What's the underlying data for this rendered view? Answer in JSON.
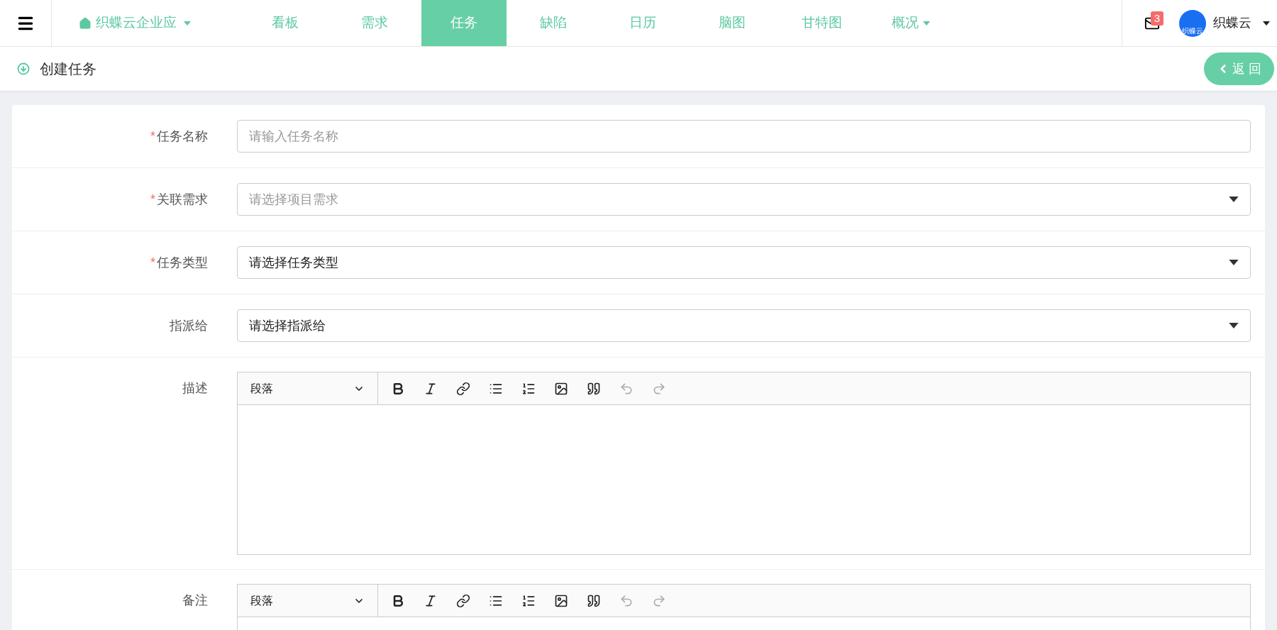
{
  "topbar": {
    "brand": {
      "label": "织蝶云企业应",
      "dropdown": true
    },
    "tabs": [
      {
        "label": "看板",
        "selected": false,
        "dropdown": false
      },
      {
        "label": "需求",
        "selected": false,
        "dropdown": false
      },
      {
        "label": "任务",
        "selected": true,
        "dropdown": false
      },
      {
        "label": "缺陷",
        "selected": false,
        "dropdown": false
      },
      {
        "label": "日历",
        "selected": false,
        "dropdown": false
      },
      {
        "label": "脑图",
        "selected": false,
        "dropdown": false
      },
      {
        "label": "甘特图",
        "selected": false,
        "dropdown": false
      },
      {
        "label": "概况",
        "selected": false,
        "dropdown": true
      }
    ],
    "mail": {
      "badge": "3"
    },
    "user": {
      "avatar_text": "织蝶云",
      "name": "织蝶云"
    }
  },
  "page_header": {
    "title": "创建任务",
    "back_button": "返 回"
  },
  "form": {
    "rows": [
      {
        "kind": "input",
        "required_mark": "*",
        "label": "任务名称",
        "placeholder": "请输入任务名称"
      },
      {
        "kind": "select",
        "required_mark": "*",
        "label": "关联需求",
        "placeholder": "请选择项目需求"
      },
      {
        "kind": "select",
        "required_mark": "*",
        "label": "任务类型",
        "value": "请选择任务类型"
      },
      {
        "kind": "select",
        "label": "指派给",
        "value": "请选择指派给"
      },
      {
        "kind": "editor",
        "label": "描述",
        "format": "段落",
        "tools": [
          {
            "kind": "bold",
            "disabled": false
          },
          {
            "kind": "italic",
            "disabled": false
          },
          {
            "kind": "link",
            "disabled": false
          },
          {
            "kind": "bullet-list",
            "disabled": false
          },
          {
            "kind": "numbered-list",
            "disabled": false
          },
          {
            "kind": "image",
            "disabled": false
          },
          {
            "kind": "quote",
            "disabled": false
          },
          {
            "kind": "undo",
            "disabled": true
          },
          {
            "kind": "redo",
            "disabled": true
          }
        ]
      },
      {
        "kind": "editor",
        "label": "备注",
        "format": "段落",
        "tools": [
          {
            "kind": "bold",
            "disabled": false
          },
          {
            "kind": "italic",
            "disabled": false
          },
          {
            "kind": "link",
            "disabled": false
          },
          {
            "kind": "bullet-list",
            "disabled": false
          },
          {
            "kind": "numbered-list",
            "disabled": false
          },
          {
            "kind": "image",
            "disabled": false
          },
          {
            "kind": "quote",
            "disabled": false
          },
          {
            "kind": "undo",
            "disabled": true
          },
          {
            "kind": "redo",
            "disabled": true
          }
        ]
      }
    ]
  }
}
